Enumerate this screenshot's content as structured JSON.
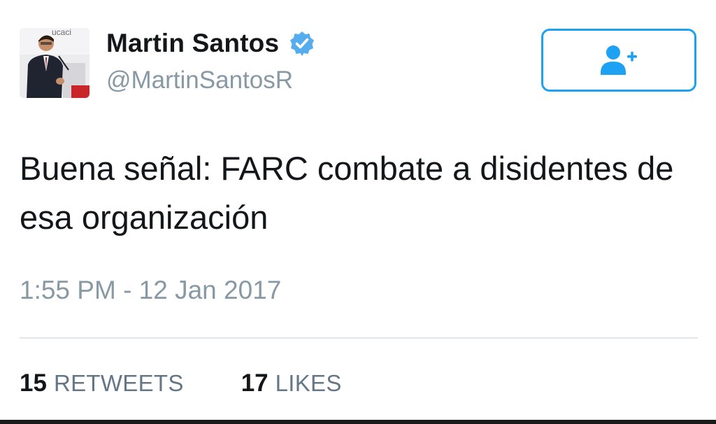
{
  "user": {
    "display_name": "Martin Santos",
    "handle": "@MartinSantosR",
    "verified": true
  },
  "follow_button": {
    "icon": "add-user-icon"
  },
  "tweet": {
    "text": "Buena señal: FARC combate a disidentes de esa organización",
    "timestamp": "1:55 PM - 12 Jan 2017"
  },
  "stats": {
    "retweets_count": "15",
    "retweets_label": "RETWEETS",
    "likes_count": "17",
    "likes_label": "LIKES"
  },
  "colors": {
    "accent": "#1da1f2",
    "text": "#14171a",
    "secondary": "#8899a6"
  }
}
